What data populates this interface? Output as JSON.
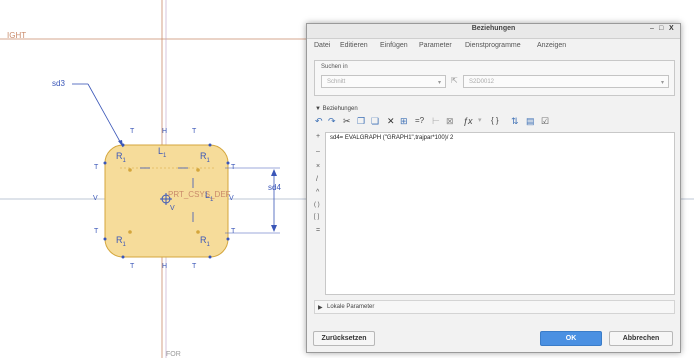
{
  "sketch": {
    "label_top_left": "IGHT",
    "dim_left": "sd3",
    "dim_right": "sd4",
    "csys_label": "PRT_CSYS_DEF",
    "label_bottom": "FOR",
    "tangent": "T",
    "horizontal": "H",
    "vertical": "V",
    "radius": "R",
    "radius_sub": "1",
    "length": "L",
    "length_sub": "1",
    "fill_color": "#f6dc9a",
    "outline_color": "#d4a63c",
    "constraint_color": "#3a56b8"
  },
  "dialog": {
    "title": "Beziehungen",
    "controls": [
      "–",
      "□",
      "X"
    ],
    "menu": [
      "Datei",
      "Editieren",
      "Einfügen",
      "Parameter",
      "Dienstprogramme",
      "Anzeigen"
    ],
    "search": {
      "legend": "Suchen in",
      "type_value": "Schnitt",
      "item_value": "S2D0012"
    },
    "relations": {
      "header": "Beziehungen",
      "toolbar_icons": [
        "undo-icon",
        "redo-icon",
        "cut-icon",
        "copy-icon",
        "paste-icon",
        "delete-icon",
        "insert-parameter-icon",
        "evaluate-icon",
        "dimension-icon",
        "verify-icon",
        "function-icon",
        "dropdown-icon",
        "braces-icon",
        "sort-icon",
        "table-icon",
        "check-icon"
      ],
      "operators": [
        "+",
        "–",
        "×",
        "/",
        "^",
        "( )",
        "[ ]",
        "="
      ],
      "code": "sd4= EVALGRAPH (\"GRAPH1\",trajpar*100)/ 2"
    },
    "local_params_label": "Lokale Parameter",
    "reset_label": "Zurücksetzen",
    "ok_label": "OK",
    "cancel_label": "Abbrechen"
  }
}
